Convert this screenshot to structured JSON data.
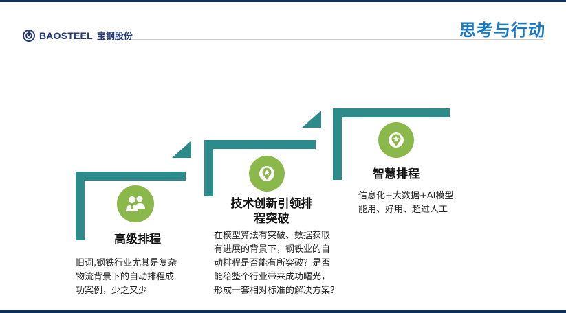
{
  "header": {
    "logo_name": "BAOSTEEL",
    "logo_cn": "宝钢股份",
    "slide_title": "思考与行动"
  },
  "colors": {
    "teal": "#2e8b8b",
    "green": "#8ab84a",
    "title_blue": "#1a78c2"
  },
  "steps": [
    {
      "icon": "people-icon",
      "title_lines": [
        "高级排程"
      ],
      "desc_lines": [
        "旧词,钢铁行业尤其是复杂",
        "物流背景下的自动排程成",
        "功案例，少之又少"
      ]
    },
    {
      "icon": "star-map-pin-icon",
      "title_lines": [
        "技术创新引领排",
        "程突破"
      ],
      "desc_lines": [
        "在模型算法有突破、数据获取",
        "有进展的背景下，钢铁业的自",
        "动排程是否能有所突破？是否",
        "能给整个行业带来成功曙光，",
        "形成一套相对标准的解决方案？"
      ]
    },
    {
      "icon": "star-map-pin-icon",
      "title_lines": [
        "智慧排程"
      ],
      "desc_lines": [
        "信息化+大数据+AI模型",
        "能用、好用、超过人工"
      ]
    }
  ]
}
